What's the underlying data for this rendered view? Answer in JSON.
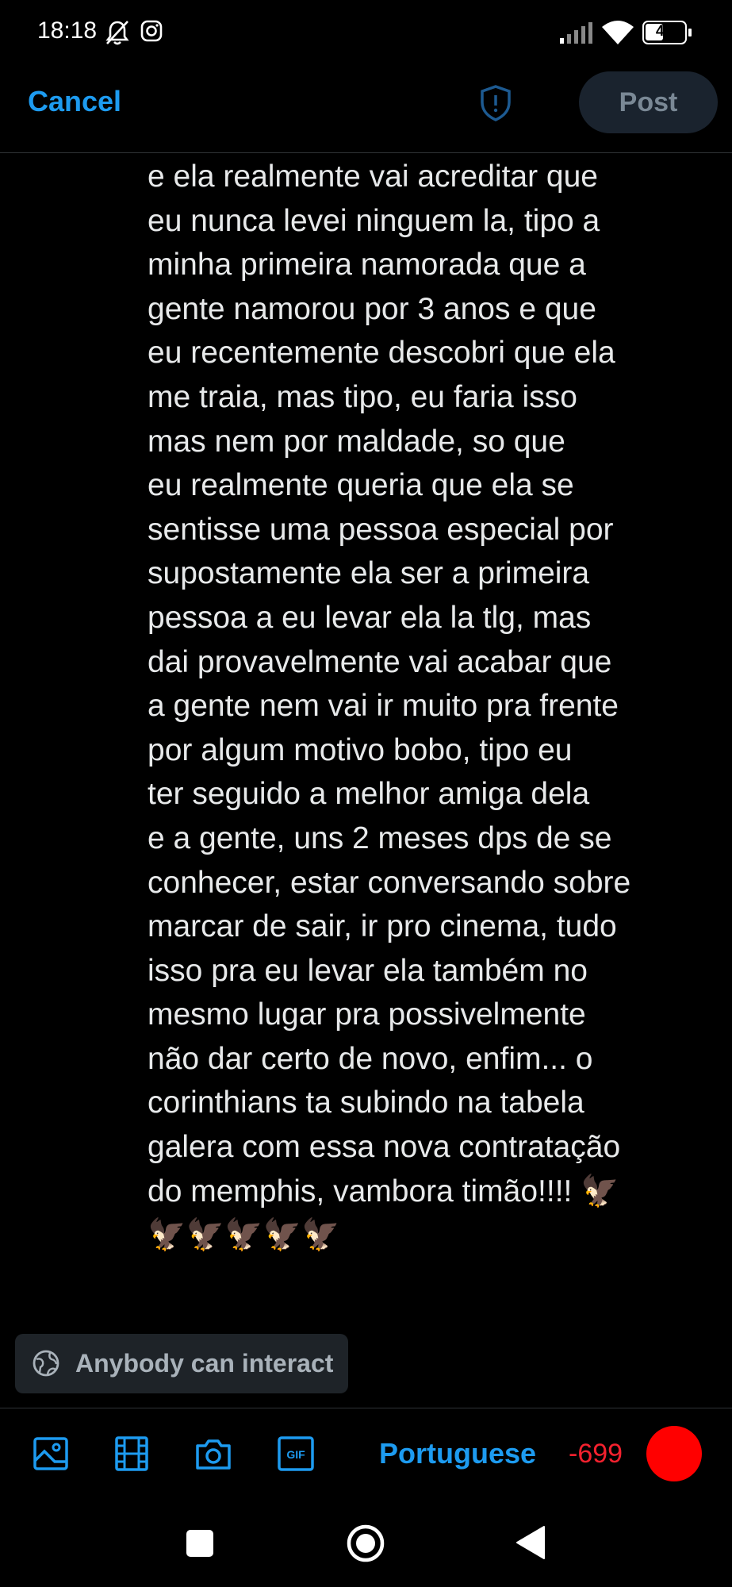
{
  "status_bar": {
    "time": "18:18",
    "battery": "43",
    "icons": [
      "mute-bell-icon",
      "instagram-icon",
      "signal-icon",
      "wifi-icon",
      "battery-icon"
    ]
  },
  "header": {
    "cancel_label": "Cancel",
    "shield_icon": "shield-alert-icon",
    "post_label": "Post"
  },
  "post": {
    "lines": [
      "e ela realmente vai acreditar que",
      "eu nunca levei ninguem la, tipo a",
      "minha primeira namorada que a",
      "gente namorou por 3 anos e que",
      "eu recentemente descobri que ela",
      "me traia, mas tipo, eu faria isso",
      "mas nem por maldade, so que",
      "eu realmente queria que ela se",
      "sentisse uma pessoa especial por",
      "supostamente ela ser a primeira",
      "pessoa a eu levar ela la tlg, mas",
      "dai provavelmente vai acabar que",
      "a gente nem vai ir muito pra frente",
      "por algum motivo bobo, tipo eu",
      "ter seguido a melhor amiga dela",
      "e a gente, uns 2 meses dps de se",
      "conhecer, estar conversando sobre",
      "marcar de sair, ir pro cinema, tudo",
      "isso pra eu levar ela também no",
      "mesmo lugar pra possivelmente",
      "não dar certo de novo, enfim... o",
      "corinthians ta subindo na tabela",
      "galera com essa nova contratação",
      "do memphis, vambora timão!!!! 🦅",
      "🦅🦅🦅🦅🦅"
    ]
  },
  "reply_settings": {
    "label": "Anybody can interact",
    "icon": "globe-icon"
  },
  "toolbar": {
    "tools": [
      "image-icon",
      "gif-film-icon",
      "camera-icon",
      "gif-icon"
    ],
    "language": "Portuguese",
    "char_remaining": "-699"
  },
  "colors": {
    "accent": "#1d9bf0",
    "error": "#f4212e",
    "background": "#000000",
    "text": "#e7e9ea"
  }
}
